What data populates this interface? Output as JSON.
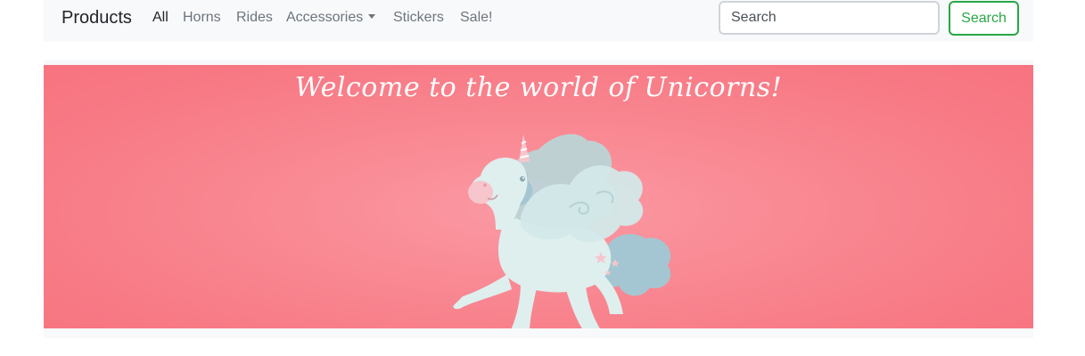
{
  "navbar": {
    "brand": "Products",
    "links": [
      {
        "label": "All",
        "active": true
      },
      {
        "label": "Horns"
      },
      {
        "label": "Rides"
      },
      {
        "label": "Accessories",
        "dropdown": true
      },
      {
        "label": "Stickers"
      },
      {
        "label": "Sale!"
      }
    ],
    "search": {
      "placeholder": "Search",
      "button_label": "Search"
    }
  },
  "hero": {
    "title": "Welcome to the world of Unicorns!",
    "image": "unicorn-illustration"
  },
  "colors": {
    "navbar_bg": "#f8f9fa",
    "hero_bg": "#f77a85",
    "search_accent": "#28a745",
    "unicorn_body": "#deefee",
    "unicorn_mane": "#a4c6d2"
  }
}
